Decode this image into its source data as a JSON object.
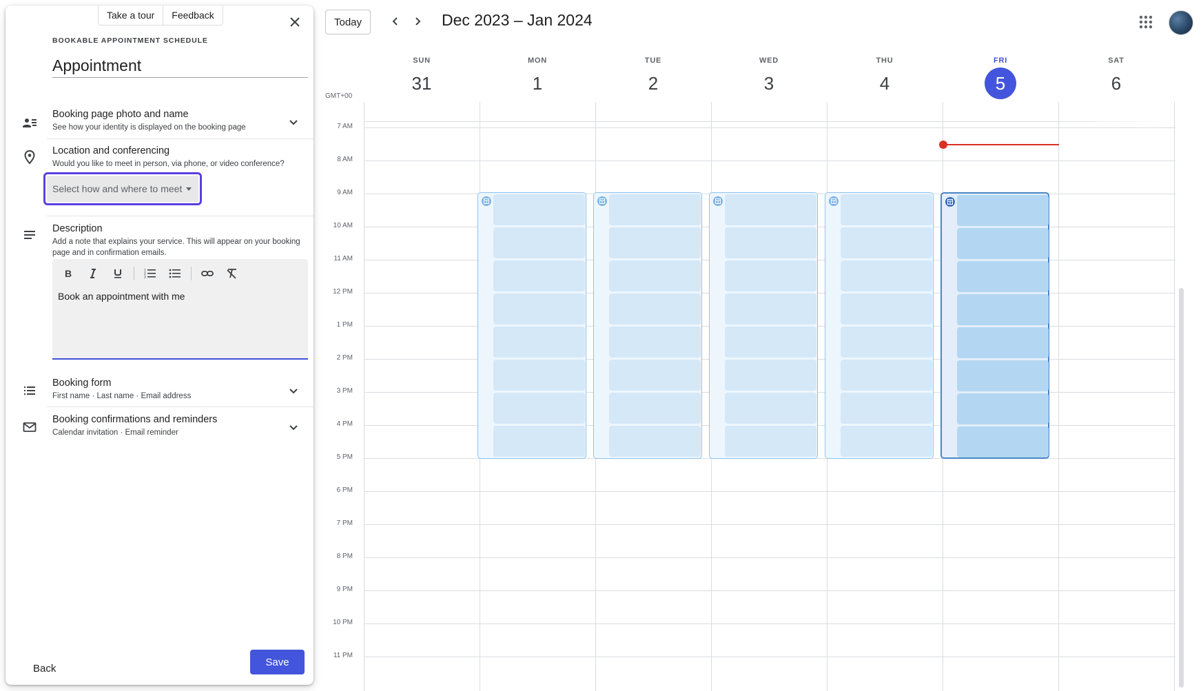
{
  "header": {
    "today_label": "Today",
    "range_title": "Dec 2023 – Jan 2024",
    "prev_icon": "chevron-left-icon",
    "next_icon": "chevron-right-icon",
    "apps_icon": "apps-grid-icon"
  },
  "calendar": {
    "timezone": "GMT+00",
    "days": [
      {
        "name": "SUN",
        "num": "31"
      },
      {
        "name": "MON",
        "num": "1"
      },
      {
        "name": "TUE",
        "num": "2"
      },
      {
        "name": "WED",
        "num": "3"
      },
      {
        "name": "THU",
        "num": "4"
      },
      {
        "name": "FRI",
        "num": "5"
      },
      {
        "name": "SAT",
        "num": "6"
      }
    ],
    "today_index": 5,
    "hours": [
      "7 AM",
      "8 AM",
      "9 AM",
      "10 AM",
      "11 AM",
      "12 PM",
      "1 PM",
      "2 PM",
      "3 PM",
      "4 PM",
      "5 PM",
      "6 PM",
      "7 PM",
      "8 PM",
      "9 PM",
      "10 PM",
      "11 PM"
    ],
    "appointment_days": [
      1,
      2,
      3,
      4,
      5
    ],
    "appointment_start": "9 AM",
    "appointment_end": "5 PM",
    "slots_per_block": 8,
    "colors": {
      "accent": "#4355dc",
      "now_line": "#d93025",
      "slot": "#d4e8f8",
      "slot_selected": "#b3d7f2"
    }
  },
  "panel": {
    "tour_label": "Take a tour",
    "feedback_label": "Feedback",
    "kicker": "BOOKABLE APPOINTMENT SCHEDULE",
    "title_value": "Appointment",
    "sections": {
      "photo": {
        "title": "Booking page photo and name",
        "subtitle": "See how your identity is displayed on the booking page"
      },
      "location": {
        "title": "Location and conferencing",
        "subtitle": "Would you like to meet in person, via phone, or video conference?"
      },
      "description": {
        "title": "Description",
        "subtitle": "Add a note that explains your service. This will appear on your booking page and in confirmation emails."
      },
      "form": {
        "title": "Booking form",
        "subtitle": "First name · Last name · Email address"
      },
      "confirm": {
        "title": "Booking confirmations and reminders",
        "subtitle": "Calendar invitation · Email reminder"
      }
    },
    "location_select": "Select how and where to meet",
    "description_text": "Book an appointment with me",
    "back_label": "Back",
    "save_label": "Save"
  }
}
